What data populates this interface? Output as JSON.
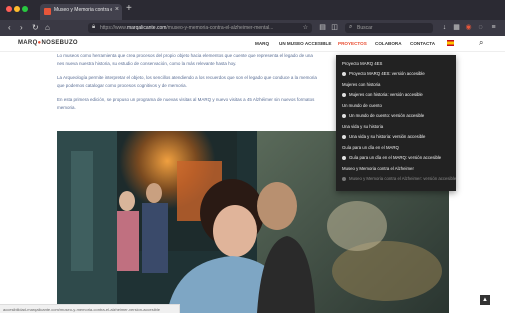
{
  "browser": {
    "tab_title": "Museo y Memoria contra el Alzhe...",
    "tab_close": "×",
    "new_tab": "+",
    "url_prefix": "https://www.",
    "url_domain": "marqalicante.com",
    "url_path": "/museo-y-memoria-contra-el-alzheimer-mental...",
    "search_placeholder": "Buscar",
    "back": "‹",
    "forward": "›",
    "reload": "↻",
    "home": "⌂"
  },
  "site": {
    "logo_prefix": "MARQ",
    "logo_dot": "●",
    "logo_suffix": "NOSEBUZO",
    "menu": [
      "MARQ",
      "UN MUSEO ACCESIBLE",
      "PROYECTOS",
      "COLABORA",
      "CONTACTA"
    ],
    "active_menu_index": 2
  },
  "content": {
    "paragraphs": [
      "Lo museos como herramienta que crea procesos del propio objeto hacia elementos que cuente que representa el legado de una",
      "nes nueva nuestra historia, su estudio de conservación, como la más relevante hasta hoy.",
      "La Arqueología permite interpretar el objeto, los sencillos atendiendo a los recuerdos que son el legado que conduce a la memoria",
      "que podemos catalogar como procesos cognitivos y de memoria.",
      "En esta primera edición, se propuso un programa de nuevas visitas al MARQ y nuevo visitas a 45 Alzhéimer sin nuevos formatos",
      "memoria."
    ]
  },
  "dropdown": {
    "items": [
      {
        "text": "Proyecto MARQ 4ES",
        "kind": "header"
      },
      {
        "text": "Proyecto MARQ 4ES: versión accesible",
        "kind": "bullet"
      },
      {
        "text": "Mujeres con historia",
        "kind": "header"
      },
      {
        "text": "Mujeres con historia: versión accesible",
        "kind": "bullet"
      },
      {
        "text": "Un mundo de cuento",
        "kind": "header"
      },
      {
        "text": "Un mundo de cuento: versión accesible",
        "kind": "bullet"
      },
      {
        "text": "Una vida y su historia",
        "kind": "header"
      },
      {
        "text": "Una vida y su historia: versión accesible",
        "kind": "bullet"
      },
      {
        "text": "Guía para un día en el MARQ",
        "kind": "header"
      },
      {
        "text": "Guía para un día en el MARQ: versión accesible",
        "kind": "bullet"
      },
      {
        "text": "Museo y Memoria contra el Alzheimer",
        "kind": "header"
      },
      {
        "text": "Museo y Memoria contra el Alzheimer: versión accesible",
        "kind": "bullet-dim"
      }
    ]
  },
  "status": {
    "text": "accesibilidad-marqalicante.com/museo-y-memoria-contra-el-alzheimer-version-accesible"
  },
  "back_to_top": "▲"
}
